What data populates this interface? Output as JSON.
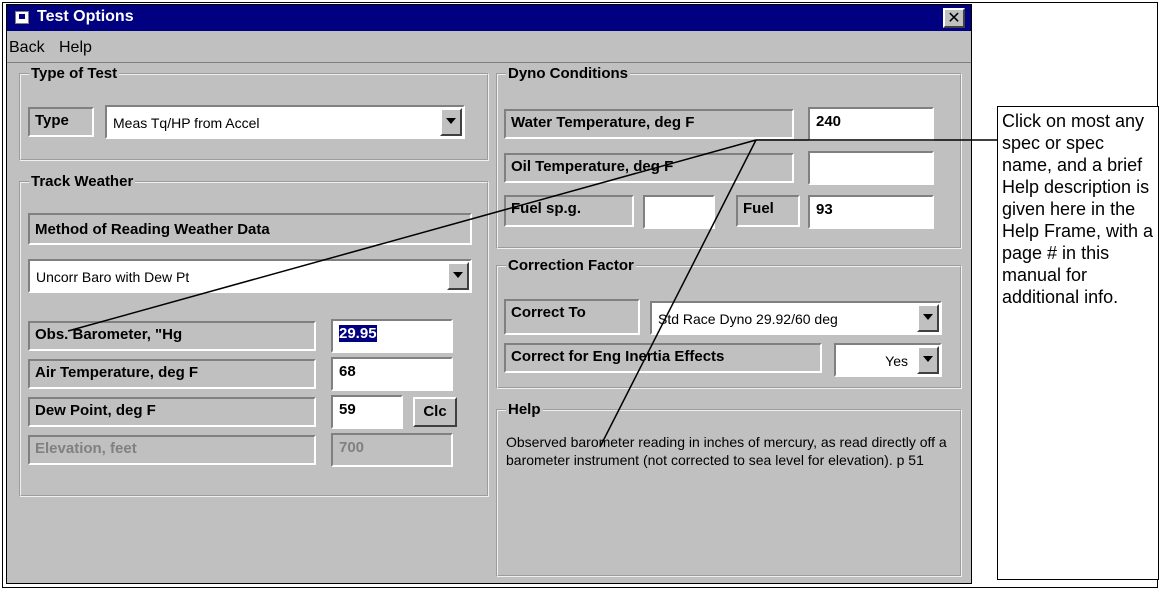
{
  "window": {
    "title": "Test Options",
    "close_glyph": "✕"
  },
  "menu": {
    "items": [
      "Back",
      "Help"
    ]
  },
  "type_of_test": {
    "group_title": "Type of Test",
    "label": "Type",
    "value": "Meas Tq/HP from Accel"
  },
  "track_weather": {
    "group_title": "Track Weather",
    "method_label": "Method of Reading Weather Data",
    "method_value": "Uncorr Baro with Dew Pt",
    "obs_baro_label": "Obs. Barometer, \"Hg",
    "obs_baro_value": "29.95",
    "air_temp_label": "Air Temperature, deg F",
    "air_temp_value": "68",
    "dew_point_label": "Dew Point, deg F",
    "dew_point_value": "59",
    "clc_button": "Clc",
    "elevation_label": "Elevation, feet",
    "elevation_value": "700"
  },
  "dyno_conditions": {
    "group_title": "Dyno Conditions",
    "water_temp_label": "Water Temperature, deg F",
    "water_temp_value": "240",
    "oil_temp_label": "Oil Temperature, deg F",
    "oil_temp_value": "",
    "fuel_spg_label": "Fuel sp.g.",
    "fuel_spg_value": "",
    "fuel_label": "Fuel",
    "fuel_value": "93"
  },
  "correction_factor": {
    "group_title": "Correction Factor",
    "correct_to_label": "Correct To",
    "correct_to_value": "Std Race Dyno 29.92/60 deg",
    "inertia_label": "Correct for Eng Inertia Effects",
    "inertia_value": "Yes"
  },
  "help": {
    "group_title": "Help",
    "text": "Observed barometer reading in inches of mercury, as read directly off a barometer instrument (not corrected to sea level for elevation).   p 51"
  },
  "callout": {
    "text": "Click on most any spec or spec name, and a brief Help description is given here in the Help Frame, with a page # in this manual for additional info."
  },
  "colors": {
    "titlebar": "#000080",
    "face": "#c0c0c0",
    "selection": "#000080"
  },
  "icons": [
    "window-icon",
    "close-icon",
    "dropdown-arrow-icon"
  ]
}
